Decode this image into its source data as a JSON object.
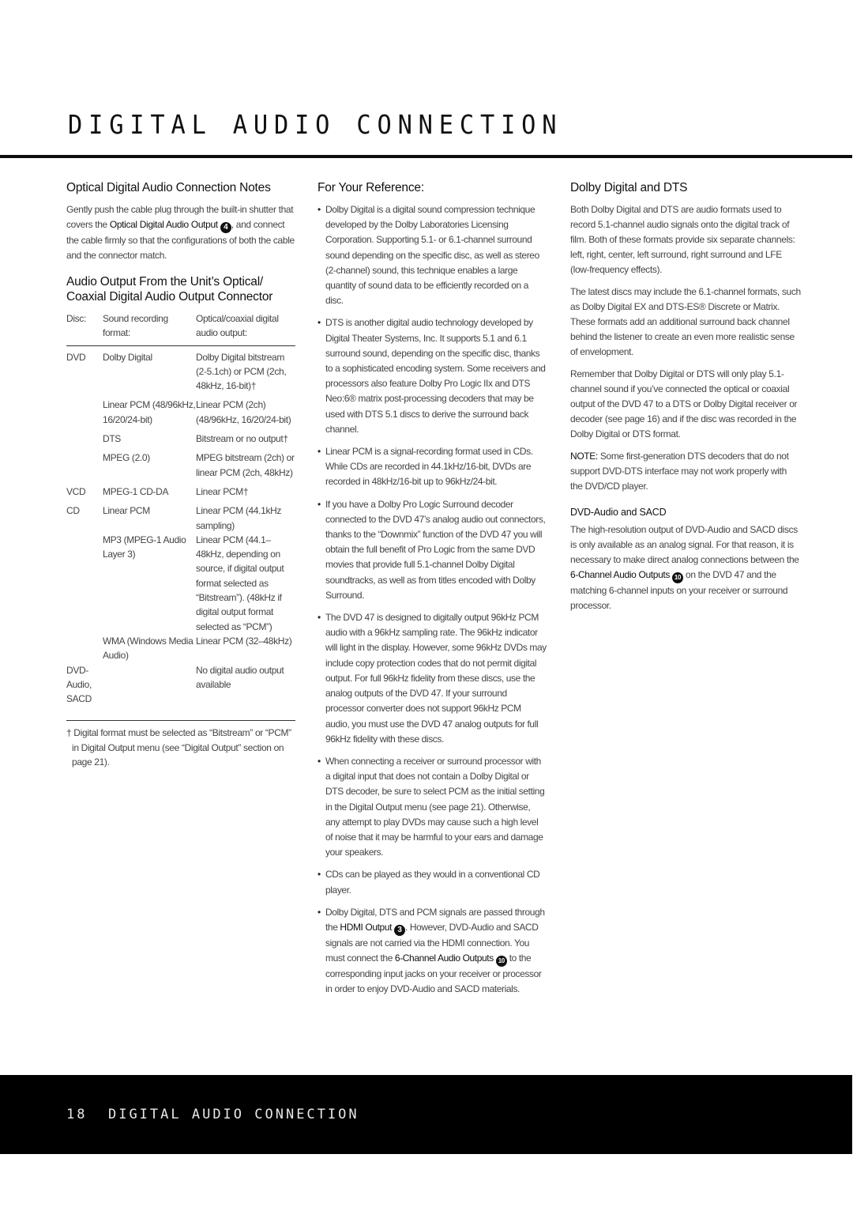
{
  "header": {
    "title": "DIGITAL AUDIO CONNECTION"
  },
  "col1": {
    "optical_heading": "Optical Digital Audio Connection Notes",
    "optical_body_pre": "Gently push the cable plug through the built-in shutter that covers the ",
    "optical_body_bold": "Optical Digital Audio Output",
    "optical_body_num": "4",
    "optical_body_post": ", and connect the cable firmly so that the configurations of both the cable and the connector match.",
    "output_heading": "Audio Output From the Unit’s Optical/ Coaxial Digital Audio Output Connector",
    "table": {
      "headers": [
        "Disc:",
        "Sound recording format:",
        "Optical/coaxial digital audio output:"
      ],
      "rows": [
        {
          "disc": "DVD",
          "format": "Dolby Digital",
          "output": "Dolby Digital bitstream (2-5.1ch) or PCM (2ch, 48kHz, 16-bit)†"
        },
        {
          "disc": "",
          "format": "Linear PCM (48/96kHz, 16/20/24-bit)",
          "output": "Linear PCM (2ch) (48/96kHz, 16/20/24-bit)"
        },
        {
          "disc": "",
          "format": "DTS",
          "output": "Bitstream or no output†"
        },
        {
          "disc": "",
          "format": "MPEG (2.0)",
          "output": "MPEG bitstream (2ch) or linear PCM (2ch, 48kHz)"
        },
        {
          "disc": "VCD",
          "format": "MPEG-1 CD-DA",
          "output": "Linear PCM†"
        },
        {
          "disc": "CD",
          "format": "Linear PCM",
          "output": "Linear PCM (44.1kHz sampling)"
        },
        {
          "disc": "",
          "format": "MP3 (MPEG-1 Audio Layer 3)",
          "output": "Linear PCM (44.1–48kHz, depending on source, if digital output format selected as “Bitstream”). (48kHz if digital output format selected as “PCM”)"
        },
        {
          "disc": "",
          "format": "WMA (Windows Media Audio)",
          "output": "Linear PCM (32–48kHz)"
        },
        {
          "disc": "DVD-Audio, SACD",
          "format": "",
          "output": "No digital audio output available"
        }
      ]
    },
    "footnote": "† Digital format must be selected as “Bitstream” or “PCM” in Digital Output menu (see “Digital Output” section on page 21)."
  },
  "col2": {
    "heading": "For Your Reference:",
    "bullet_char": "•",
    "items": [
      {
        "text": "Dolby Digital is a digital sound compression technique developed by the Dolby Laboratories Licensing Corporation. Supporting 5.1- or 6.1-channel surround sound depending on the specific disc, as well as stereo (2-channel) sound, this technique enables a large quantity of sound data to be efficiently recorded on a disc."
      },
      {
        "text": "DTS is another digital audio technology developed by Digital Theater Systems, Inc. It supports 5.1 and 6.1 surround sound, depending on the specific disc, thanks to a sophisticated encoding system. Some receivers and processors also feature Dolby Pro Logic IIx and DTS Neo:6® matrix post-processing decoders that may be used with DTS 5.1 discs to derive the surround back channel."
      },
      {
        "text": "Linear PCM is a signal-recording format used in CDs. While CDs are recorded in 44.1kHz/16-bit, DVDs are recorded in 48kHz/16-bit up to 96kHz/24-bit."
      },
      {
        "text": "If you have a Dolby Pro Logic Surround decoder connected to the DVD 47’s analog audio out connectors, thanks to the “Downmix” function of the DVD 47 you will obtain the full benefit of Pro Logic from the same DVD movies that provide full 5.1-channel Dolby Digital soundtracks, as well as from titles encoded with Dolby Surround."
      },
      {
        "text": "The DVD 47 is designed to digitally output 96kHz PCM audio with a 96kHz sampling rate. The 96kHz indicator will light in the display. However, some 96kHz DVDs may include copy protection codes that do not permit digital output. For full 96kHz fidelity from these discs, use the analog outputs of the DVD 47. If your surround processor converter does not support 96kHz PCM audio, you must use the DVD 47 analog outputs for full 96kHz fidelity with these discs."
      },
      {
        "text": "When connecting a receiver or surround processor with a digital input that does not contain a Dolby Digital or DTS decoder, be sure to select PCM as the initial setting in the Digital Output menu (see page 21). Otherwise, any attempt to play DVDs may cause such a high level of noise that it may be harmful to your ears and damage your speakers."
      },
      {
        "text": "CDs can be played as they would in a conventional CD player."
      }
    ],
    "last_item": {
      "pre": "Dolby Digital, DTS and PCM signals are passed through the ",
      "bold1": "HDMI Output",
      "num1": "3",
      "mid": ". However, DVD-Audio and SACD signals are not carried via the HDMI connection. You must connect the ",
      "bold2": "6-Channel Audio Outputs",
      "num2": "10",
      "post": " to the corresponding input jacks on your receiver or processor in order to enjoy DVD-Audio and SACD materials."
    }
  },
  "col3": {
    "heading": "Dolby Digital and DTS",
    "p1": "Both Dolby Digital and DTS are audio formats used to record 5.1-channel audio signals onto the digital track of film. Both of these formats provide six separate channels: left, right, center, left surround, right surround and LFE (low-frequency effects).",
    "p2": "The latest discs may include the 6.1-channel formats, such as Dolby Digital EX and DTS-ES® Discrete or Matrix. These formats add an additional surround back channel behind the listener to create an even more realistic sense of envelopment.",
    "p3": "Remember that Dolby Digital or DTS will only play 5.1-channel sound if you’ve connected the optical or coaxial output of the DVD 47 to a DTS or Dolby Digital receiver or decoder (see page 16) and if the disc was recorded in the Dolby Digital or DTS format.",
    "note_label": "NOTE:",
    "note_text": " Some first-generation DTS decoders that do not support DVD-DTS interface may not work properly with the DVD/CD player.",
    "sub_heading": "DVD-Audio and SACD",
    "p4_pre": "The high-resolution output of DVD-Audio and SACD discs is only available as an analog signal. For that reason, it is necessary to make direct analog connections between the ",
    "p4_bold": "6-Channel Audio Outputs",
    "p4_num": "10",
    "p4_post": " on the DVD 47 and the matching 6-channel inputs on your receiver or surround processor."
  },
  "footer": {
    "page_number": "18",
    "section": "DIGITAL AUDIO CONNECTION"
  }
}
